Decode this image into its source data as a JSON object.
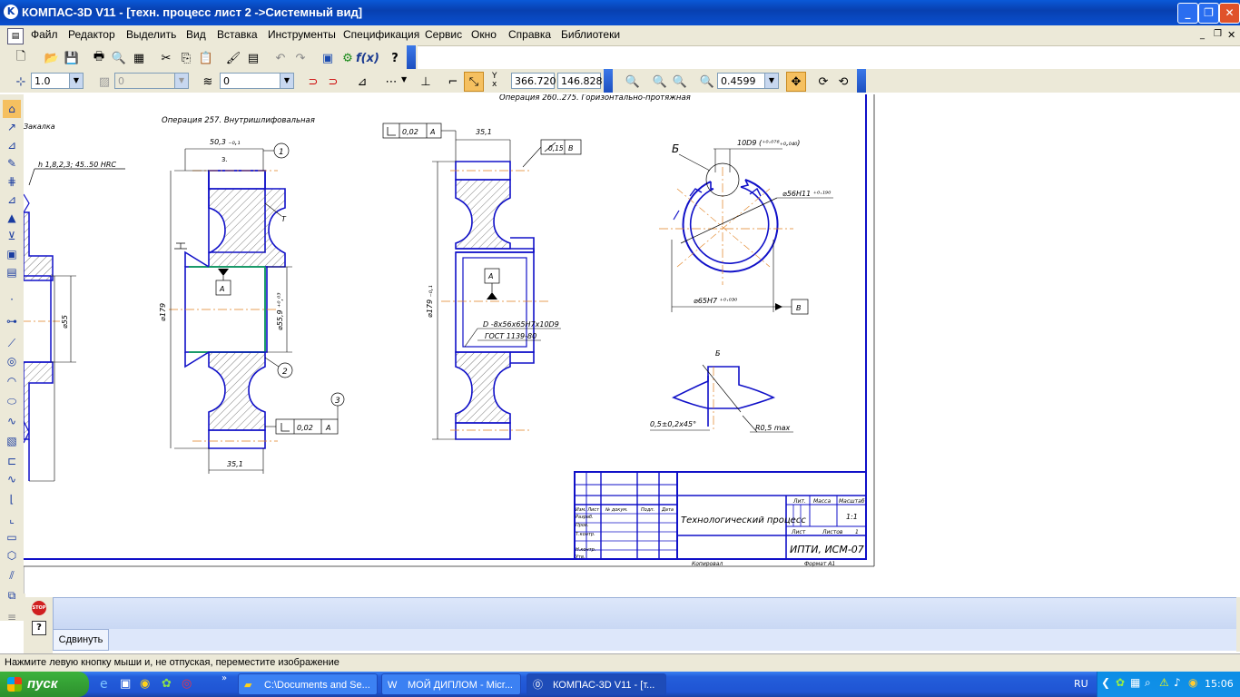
{
  "window": {
    "title": "КОМПАС-3D V11 - [техн. процесс лист 2 ->Системный вид]"
  },
  "menu": [
    "Файл",
    "Редактор",
    "Выделить",
    "Вид",
    "Вставка",
    "Инструменты",
    "Спецификация",
    "Сервис",
    "Окно",
    "Справка",
    "Библиотеки"
  ],
  "toolbar2": {
    "scale_value": "1.0",
    "layer_value": "0",
    "style_value": "0",
    "coord_x": "366.720",
    "coord_y": "146.828",
    "zoom_value": "0.4599"
  },
  "drawing": {
    "op_top": "Операция 260..275. Горизонтально-протяжная",
    "op_257": "Операция 257. Внутришлифовальная",
    "left_cut_label": "Закалка",
    "hardness_note": "h 1,8,2,3;  45..50  HRC",
    "dim_left_55": "⌀55",
    "dim_503": "50,3 ₋₀,₁",
    "dim_179": "⌀179",
    "dim_559": "⌀55,9 ⁺⁰,⁰³",
    "dim_351_a": "35,1",
    "label_T": "T",
    "label_A1": "А",
    "tol_002_a": "0,02",
    "tol_A_a": "А",
    "circle_1": "1",
    "circle_2": "2",
    "circle_3": "3",
    "dim_351_b": "35,1",
    "tol_002_b": "0,02",
    "tol_A_b": "А",
    "tol_015": "0,15",
    "tol_B": "В",
    "dim_179b": "⌀179 ₋₀,₁",
    "spline_label": "D -8x56x65H7x10D9",
    "gost_label": "ГОСТ 1139-80",
    "label_A2": "А",
    "b_label": "Б",
    "dim_10d9": "10D9 (⁺⁰·⁰⁷⁶₊₀,₀₄₀)",
    "dim_56h11": "⌀56H11 ⁺⁰·¹⁹⁰",
    "dim_65h7": "⌀65H7 ⁺⁰·⁰³⁰",
    "label_B2": "В",
    "detail_b": "Б",
    "chamfer": "0,5±0,2x45°",
    "radius": "R0,5 max",
    "stamp": {
      "title": "Технологический процесс",
      "org": "ИПТИ, ИСМ-07",
      "lit": "Лит.",
      "mass": "Масса",
      "scale": "Масштаб",
      "scale_val": "1:1",
      "sheet": "Лист",
      "sheets": "Листов",
      "sheets_val": "1",
      "rows": [
        "Изм. Лист",
        "Разраб.",
        "Пров.",
        "Т.контр.",
        "",
        "Н.контр.",
        "Утв."
      ],
      "col_docs": "№ докум.",
      "col_sign": "Подп.",
      "col_date": "Дата",
      "copied": "Копировал",
      "format": "Формат   А1"
    }
  },
  "command_panel": {
    "button_label": "Сдвинуть"
  },
  "status": {
    "hint": "Нажмите левую кнопку мыши и, не отпуская, переместите изображение"
  },
  "taskbar": {
    "start": "пуск",
    "tasks": [
      "C:\\Documents and Se...",
      "МОЙ ДИПЛОМ - Micr...",
      "КОМПАС-3D V11 - [т..."
    ],
    "lang": "RU",
    "clock": "15:06"
  }
}
